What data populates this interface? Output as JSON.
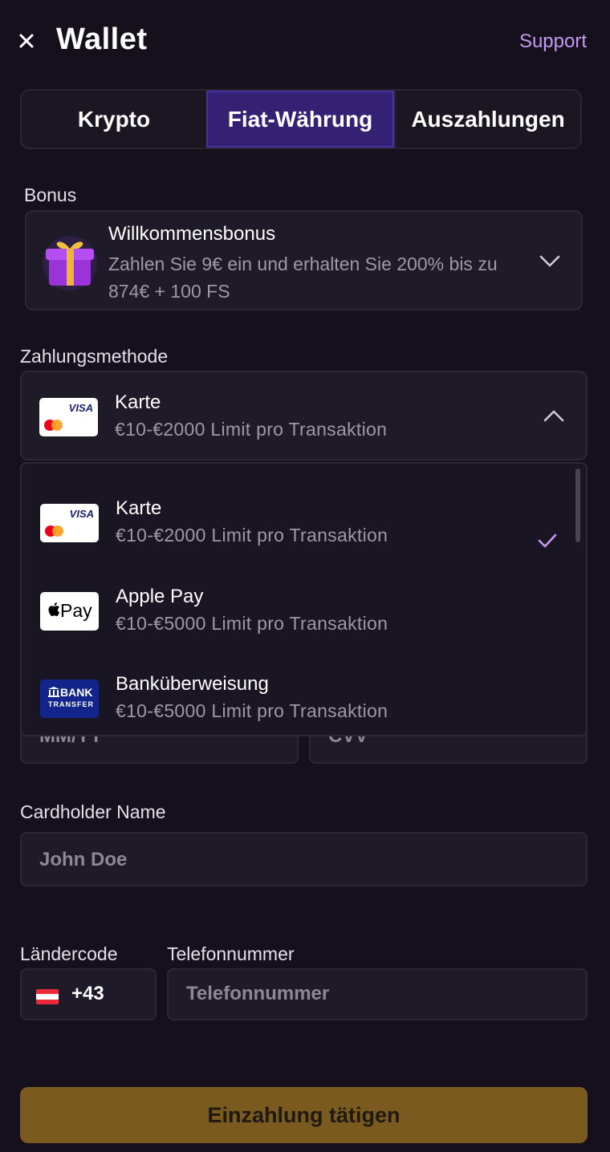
{
  "header": {
    "title": "Wallet",
    "support_label": "Support"
  },
  "tabs": [
    {
      "label": "Krypto",
      "active": false
    },
    {
      "label": "Fiat-Währung",
      "active": true
    },
    {
      "label": "Auszahlungen",
      "active": false
    }
  ],
  "bonus": {
    "label": "Bonus",
    "title": "Willkommensbonus",
    "description": "Zahlen Sie 9€ ein und erhalten Sie 200% bis zu 874€ + 100 FS"
  },
  "payment": {
    "label": "Zahlungsmethode",
    "selected": {
      "title": "Karte",
      "subtitle": "€10-€2000 Limit pro Transaktion"
    },
    "options": [
      {
        "title": "Karte",
        "subtitle": "€10-€2000 Limit pro Transaktion",
        "selected": true,
        "logo": "visa-mastercard"
      },
      {
        "title": "Apple Pay",
        "subtitle": "€10-€5000 Limit pro Transaktion",
        "selected": false,
        "logo": "apple-pay"
      },
      {
        "title": "Banküberweisung",
        "subtitle": "€10-€5000 Limit pro Transaktion",
        "selected": false,
        "logo": "bank-transfer"
      }
    ],
    "visa_text": "VISA",
    "applepay_text": "Pay",
    "bank_text": "BANK",
    "bank_sub": "TRANSFER"
  },
  "card_form": {
    "expiry_placeholder": "MM/YY",
    "cvv_placeholder": "CVV",
    "cardholder_label": "Cardholder Name",
    "cardholder_placeholder": "John Doe"
  },
  "phone": {
    "country_label": "Ländercode",
    "phone_label": "Telefonnummer",
    "dial_code": "+43",
    "phone_placeholder": "Telefonnummer"
  },
  "submit_label": "Einzahlung tätigen",
  "colors": {
    "background": "#15101c",
    "accent": "#c59af2",
    "active_tab": "#342173",
    "submit": "#7a5a1e"
  }
}
